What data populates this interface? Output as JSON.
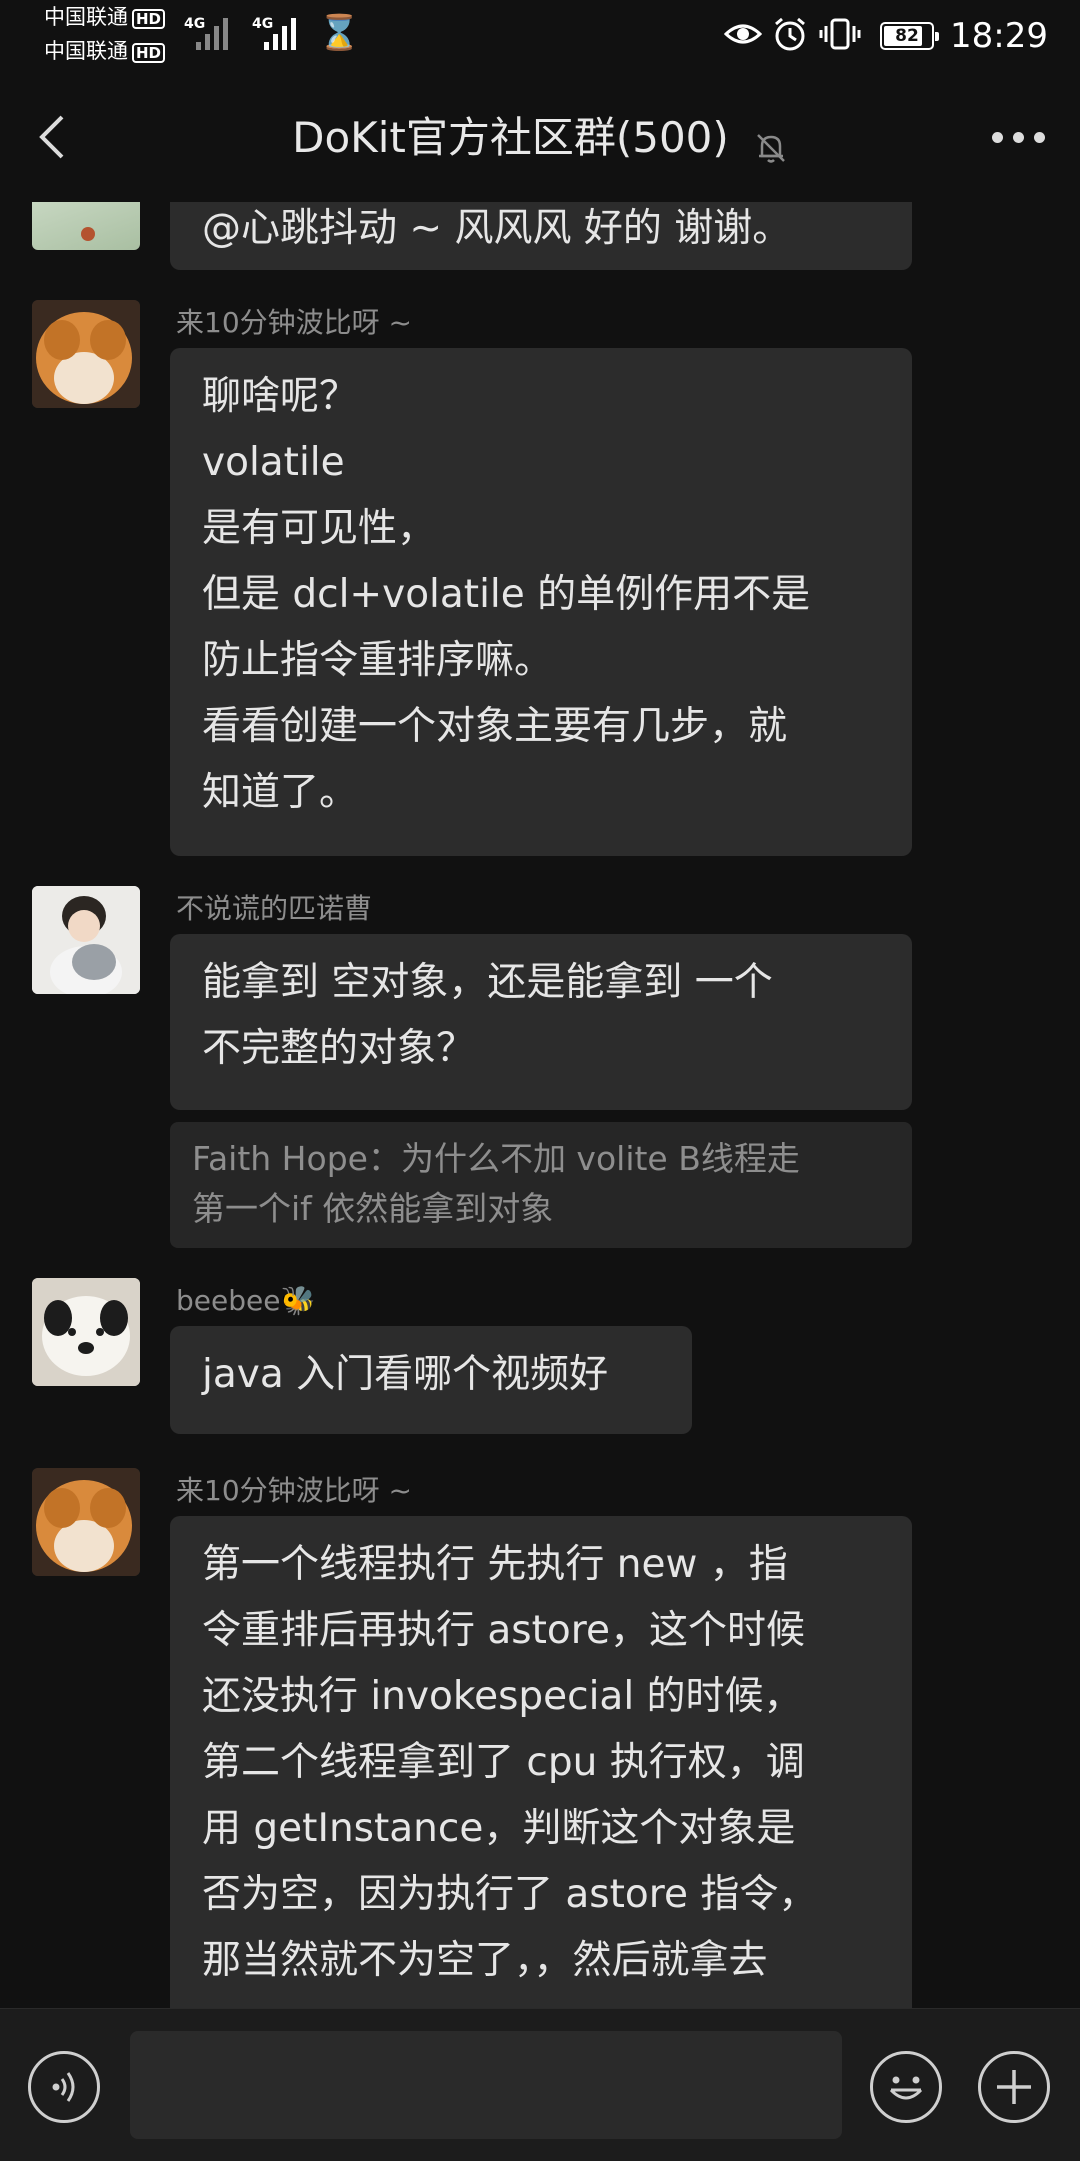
{
  "status_bar": {
    "carrier_1": "中国联通",
    "carrier_2": "中国联通",
    "hd_badge": "HD",
    "network_1": "4G",
    "network_2": "4G",
    "battery_level": "82",
    "time": "18:29"
  },
  "header": {
    "title": "DoKit官方社区群(500)"
  },
  "messages": [
    {
      "sender": "",
      "lines": [
        "@心跳抖动 ~ 风风风   好的 谢谢。"
      ]
    },
    {
      "sender": "来10分钟波比呀 ~",
      "lines": [
        "聊啥呢？",
        "volatile",
        "是有可见性，",
        "但是 dcl+volatile 的单例作用不是",
        "防止指令重排序嘛。",
        "看看创建一个对象主要有几步，就",
        "知道了。"
      ]
    },
    {
      "sender": "不说谎的匹诺曹",
      "lines": [
        "能拿到 空对象，还是能拿到 一个",
        "不完整的对象？"
      ],
      "quote": [
        "Faith Hope：为什么不加 volite  B线程走",
        "第一个if 依然能拿到对象"
      ]
    },
    {
      "sender": "beebee🐝",
      "lines": [
        "java 入门看哪个视频好"
      ]
    },
    {
      "sender": "来10分钟波比呀 ~",
      "lines": [
        "第一个线程执行 先执行 new ，指",
        "令重排后再执行 astore，这个时候",
        "还没执行 invokespecial 的时候，",
        "第二个线程拿到了 cpu 执行权，调",
        "用 getInstance，判断这个对象是",
        "否为空，因为执行了 astore 指令，",
        "那当然就不为空了，，然后就拿去"
      ]
    }
  ],
  "input": {
    "value": ""
  },
  "icons": {
    "back": "back-arrow-icon",
    "mute": "bell-off-icon",
    "more": "more-dots-icon",
    "voice": "voice-icon",
    "emoji": "emoji-icon",
    "plus": "plus-icon"
  },
  "colors": {
    "background": "#111111",
    "bubble": "#2c2c2c",
    "quote": "#262626",
    "sender_text": "#8d8d8d",
    "message_text": "#e6e6e6"
  }
}
